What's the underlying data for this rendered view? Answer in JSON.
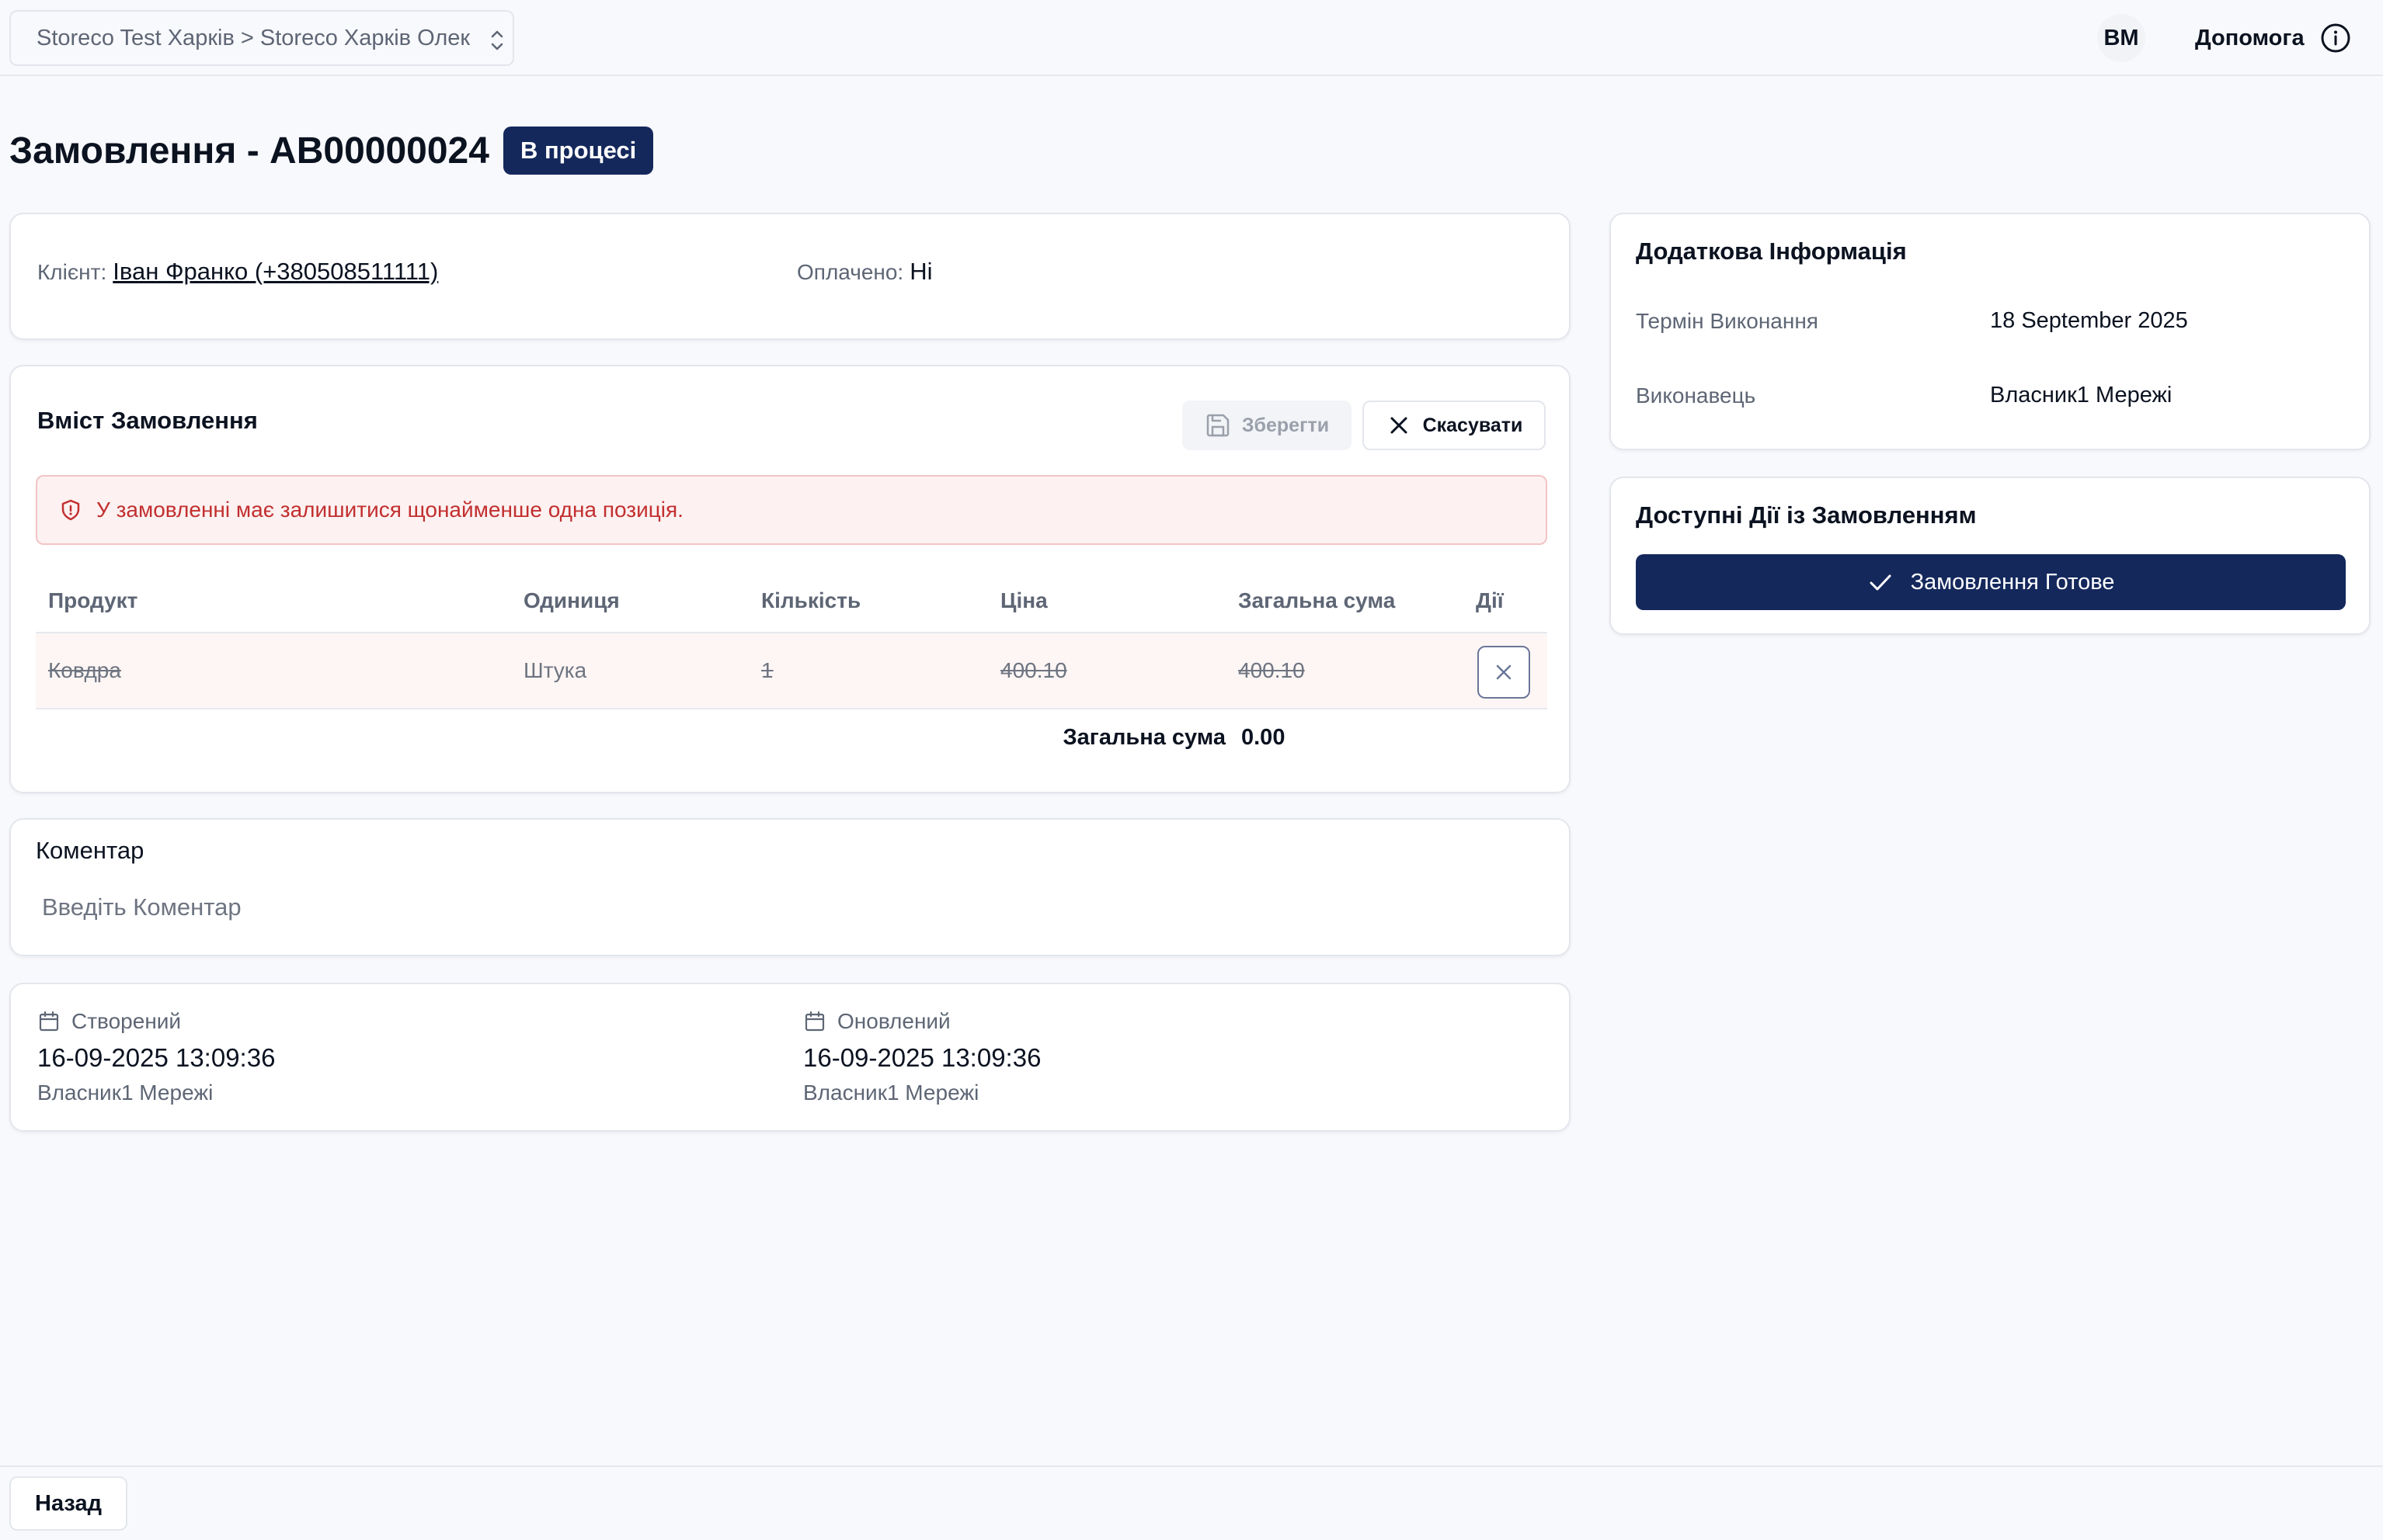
{
  "header": {
    "store_selector": "Storeco Test Харків > Storeco Харків Олек",
    "avatar_initials": "ВМ",
    "help_label": "Допомога"
  },
  "order": {
    "title": "Замовлення - AB00000024",
    "status": "В процесі"
  },
  "client_card": {
    "client_label": "Клієнт:",
    "client_value": "Іван Франко (+380508511111)",
    "paid_label": "Оплачено:",
    "paid_value": "Ні"
  },
  "content": {
    "title": "Вміст Замовлення",
    "save_label": "Зберегти",
    "cancel_label": "Скасувати",
    "alert": "У замовленні має залишитися щонайменше одна позиція.",
    "columns": [
      "Продукт",
      "Одиниця",
      "Кількість",
      "Ціна",
      "Загальна сума",
      "Дії"
    ],
    "rows": [
      {
        "product": "Ковдра",
        "unit": "Штука",
        "quantity": "1",
        "price": "400.10",
        "total": "400.10"
      }
    ],
    "total_label": "Загальна сума",
    "total_value": "0.00"
  },
  "comment": {
    "title": "Коментар",
    "placeholder": "Введіть Коментар",
    "value": ""
  },
  "dates": {
    "created_label": "Створений",
    "created_value": "16-09-2025 13:09:36",
    "created_by": "Власник1 Мережі",
    "updated_label": "Оновлений",
    "updated_value": "16-09-2025 13:09:36",
    "updated_by": "Власник1 Мережі"
  },
  "info": {
    "title": "Додаткова Інформація",
    "deadline_label": "Термін Виконання",
    "deadline_value": "18 September 2025",
    "executor_label": "Виконавець",
    "executor_value": "Власник1 Мережі"
  },
  "actions": {
    "title": "Доступні Дії із Замовленням",
    "ready_label": "Замовлення Готове"
  },
  "footer": {
    "back_label": "Назад"
  },
  "colors": {
    "brand": "#14285c",
    "alert_text": "#c22f2f",
    "alert_bg": "#fdf1f1"
  }
}
